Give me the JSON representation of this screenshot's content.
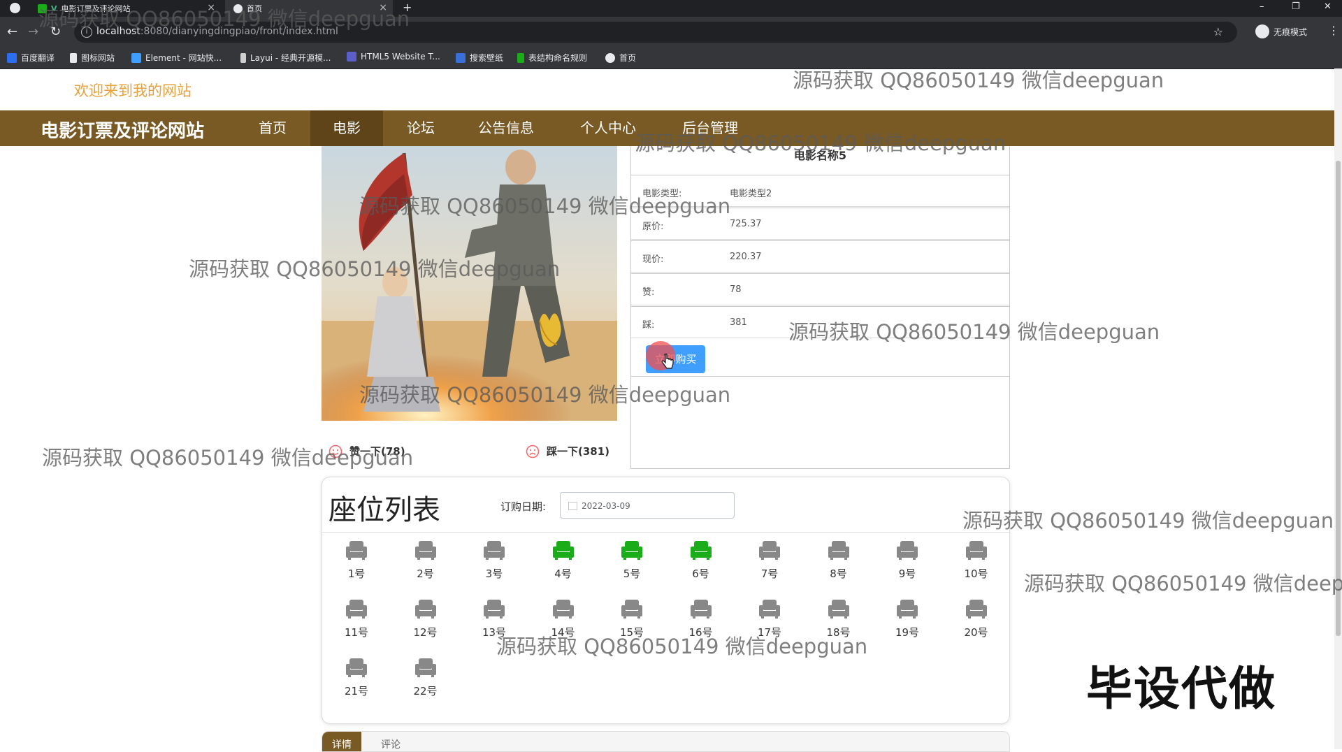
{
  "browser": {
    "tabs": [
      {
        "label": "电影订票及评论网站",
        "active": false
      },
      {
        "label": "首页",
        "active": true
      }
    ],
    "new_tab": "+",
    "window_controls": [
      "–",
      "❐",
      "✕"
    ],
    "url_host": "localhost",
    "url_rest": ":8080/dianyingdingpiao/front/index.html",
    "profile_label": "无痕模式",
    "bookmarks": [
      {
        "label": "百度翻译",
        "color": "#2b6ff0"
      },
      {
        "label": "图标网站",
        "color": "#e8eaed"
      },
      {
        "label": "Element - 网站快...",
        "color": "#409eff"
      },
      {
        "label": "Layui - 经典开源模...",
        "color": "#cfcfcf"
      },
      {
        "label": "HTML5 Website T...",
        "color": "#5b5fc7"
      },
      {
        "label": "搜索壁纸",
        "color": "#3b6fd8"
      },
      {
        "label": "表结构命名规则",
        "color": "#1aad19"
      },
      {
        "label": "首页",
        "color": "#e8eaed"
      }
    ]
  },
  "site": {
    "welcome": "欢迎来到我的网站",
    "title": "电影订票及评论网站",
    "nav": [
      {
        "label": "首页",
        "active": false
      },
      {
        "label": "电影",
        "active": true
      },
      {
        "label": "论坛",
        "active": false
      },
      {
        "label": "公告信息",
        "active": false
      },
      {
        "label": "个人中心",
        "active": false
      },
      {
        "label": "后台管理",
        "active": false
      }
    ]
  },
  "movie": {
    "name": "电影名称5",
    "rows": [
      {
        "label": "电影类型:",
        "value": "电影类型2"
      },
      {
        "label": "原价:",
        "value": "725.37"
      },
      {
        "label": "现价:",
        "value": "220.37"
      },
      {
        "label": "赞:",
        "value": "78"
      },
      {
        "label": "踩:",
        "value": "381"
      }
    ],
    "buy_label": "立即购买",
    "like_label": "赞一下(78)",
    "dislike_label": "踩一下(381)"
  },
  "seats": {
    "title": "座位列表",
    "date_label": "订购日期:",
    "date_value": "2022-03-09",
    "booked_color": "#1aad19",
    "free_color": "#888888",
    "items": [
      {
        "label": "1号",
        "booked": false
      },
      {
        "label": "2号",
        "booked": false
      },
      {
        "label": "3号",
        "booked": false
      },
      {
        "label": "4号",
        "booked": true
      },
      {
        "label": "5号",
        "booked": true
      },
      {
        "label": "6号",
        "booked": true
      },
      {
        "label": "7号",
        "booked": false
      },
      {
        "label": "8号",
        "booked": false
      },
      {
        "label": "9号",
        "booked": false
      },
      {
        "label": "10号",
        "booked": false
      },
      {
        "label": "11号",
        "booked": false
      },
      {
        "label": "12号",
        "booked": false
      },
      {
        "label": "13号",
        "booked": false
      },
      {
        "label": "14号",
        "booked": false
      },
      {
        "label": "15号",
        "booked": false
      },
      {
        "label": "16号",
        "booked": false
      },
      {
        "label": "17号",
        "booked": false
      },
      {
        "label": "18号",
        "booked": false
      },
      {
        "label": "19号",
        "booked": false
      },
      {
        "label": "20号",
        "booked": false
      },
      {
        "label": "21号",
        "booked": false
      },
      {
        "label": "22号",
        "booked": false
      }
    ]
  },
  "bottom_tabs": [
    {
      "label": "详情",
      "active": true
    },
    {
      "label": "评论",
      "active": false
    }
  ],
  "watermark": "源码获取 QQ86050149 微信deepguan",
  "stamp": "毕设代做"
}
